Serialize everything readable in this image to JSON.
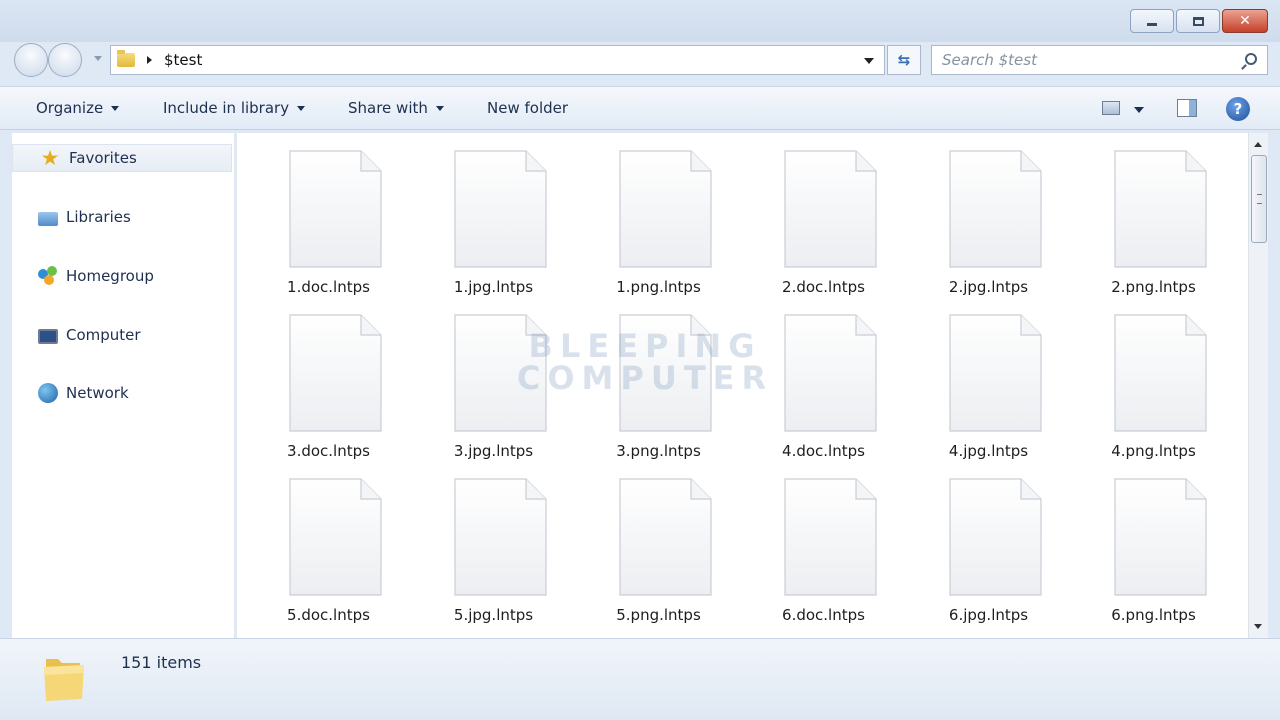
{
  "window": {
    "minimize_glyph": "minimize-icon",
    "maximize_glyph": "maximize-icon",
    "close_label": "✕"
  },
  "address": {
    "path": "$test",
    "search_placeholder": "Search $test"
  },
  "toolbar": {
    "organize": "Organize",
    "include_in_library": "Include in library",
    "share_with": "Share with",
    "new_folder": "New folder",
    "help_label": "?"
  },
  "sidebar": {
    "items": [
      {
        "label": "Favorites",
        "icon": "star-icon"
      },
      {
        "label": "Libraries",
        "icon": "libraries-icon"
      },
      {
        "label": "Homegroup",
        "icon": "homegroup-icon"
      },
      {
        "label": "Computer",
        "icon": "computer-icon"
      },
      {
        "label": "Network",
        "icon": "network-icon"
      }
    ]
  },
  "files": [
    "1.doc.lntps",
    "1.jpg.lntps",
    "1.png.lntps",
    "2.doc.lntps",
    "2.jpg.lntps",
    "2.png.lntps",
    "3.doc.lntps",
    "3.jpg.lntps",
    "3.png.lntps",
    "4.doc.lntps",
    "4.jpg.lntps",
    "4.png.lntps",
    "5.doc.lntps",
    "5.jpg.lntps",
    "5.png.lntps",
    "6.doc.lntps",
    "6.jpg.lntps",
    "6.png.lntps"
  ],
  "watermark": {
    "line1": "BLEEPING",
    "line2": "COMPUTER"
  },
  "status": {
    "item_count": "151 items"
  },
  "colors": {
    "chrome": "#dfe9f5",
    "accent": "#1e3050",
    "close_button": "#c7402a"
  }
}
